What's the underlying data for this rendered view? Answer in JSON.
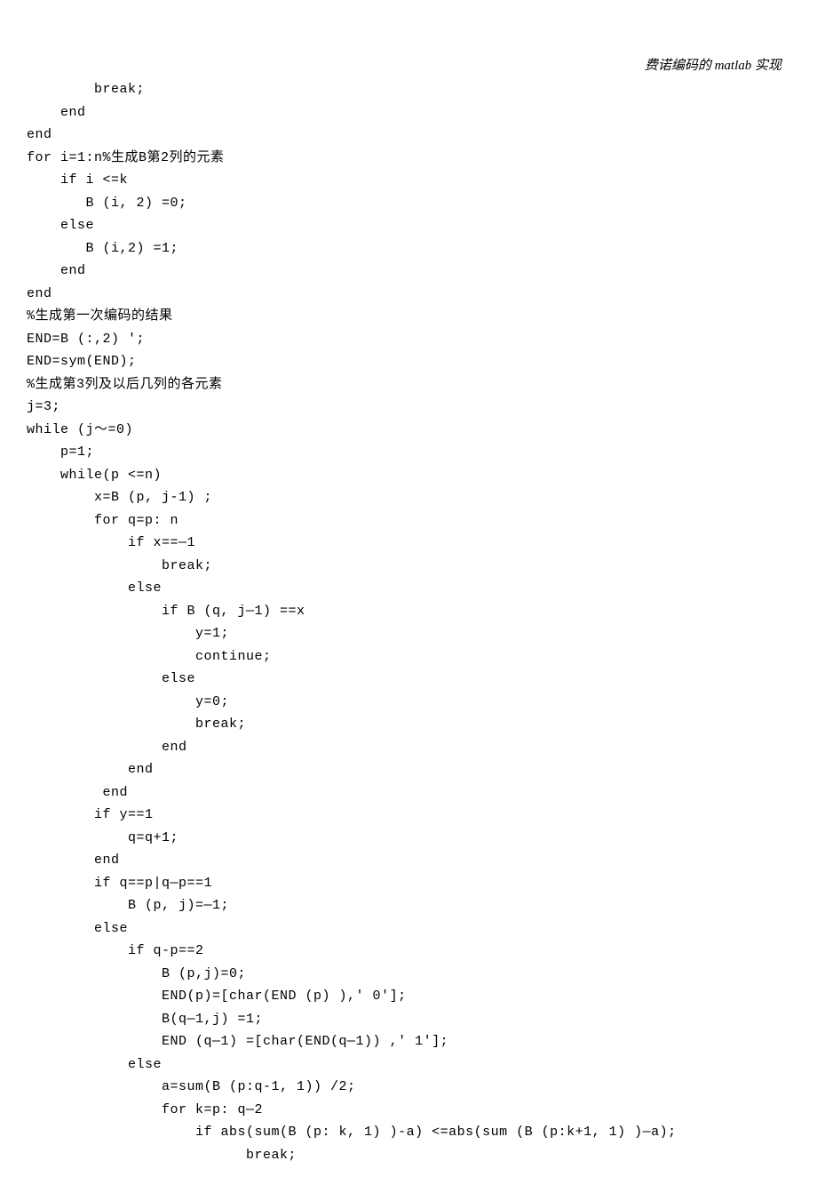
{
  "header": "费诺编码的 matlab 实现",
  "code_lines": [
    "        break;",
    "    end",
    "end",
    "for i=1:n%生成B第2列的元素",
    "    if i <=k",
    "       B (i, 2) =0;",
    "    else",
    "       B (i,2) =1;",
    "    end",
    "end",
    "%生成第一次编码的结果",
    "END=B (:,2) ';",
    "END=sym(END);",
    "%生成第3列及以后几列的各元素",
    "j=3;",
    "while (j～=0)",
    "    p=1;",
    "    while(p <=n)",
    "        x=B (p, j-1) ;",
    "        for q=p: n",
    "            if x==—1",
    "                break;",
    "            else",
    "                if B (q, j—1) ==x",
    "                    y=1;",
    "                    continue;",
    "                else",
    "                    y=0;",
    "                    break;",
    "                end",
    "            end",
    "         end",
    "        if y==1",
    "            q=q+1;",
    "        end",
    "        if q==p|q—p==1",
    "            B (p, j)=—1;",
    "        else",
    "            if q-p==2",
    "                B (p,j)=0;",
    "                END(p)=[char(END (p) ),' 0'];",
    "                B(q—1,j) =1;",
    "                END (q—1) =[char(END(q—1)) ,' 1'];",
    "            else",
    "                a=sum(B (p:q-1, 1)) /2;",
    "                for k=p: q—2",
    "                    if abs(sum(B (p: k, 1) )-a) <=abs(sum (B (p:k+1, 1) )—a);",
    "                          break;"
  ]
}
